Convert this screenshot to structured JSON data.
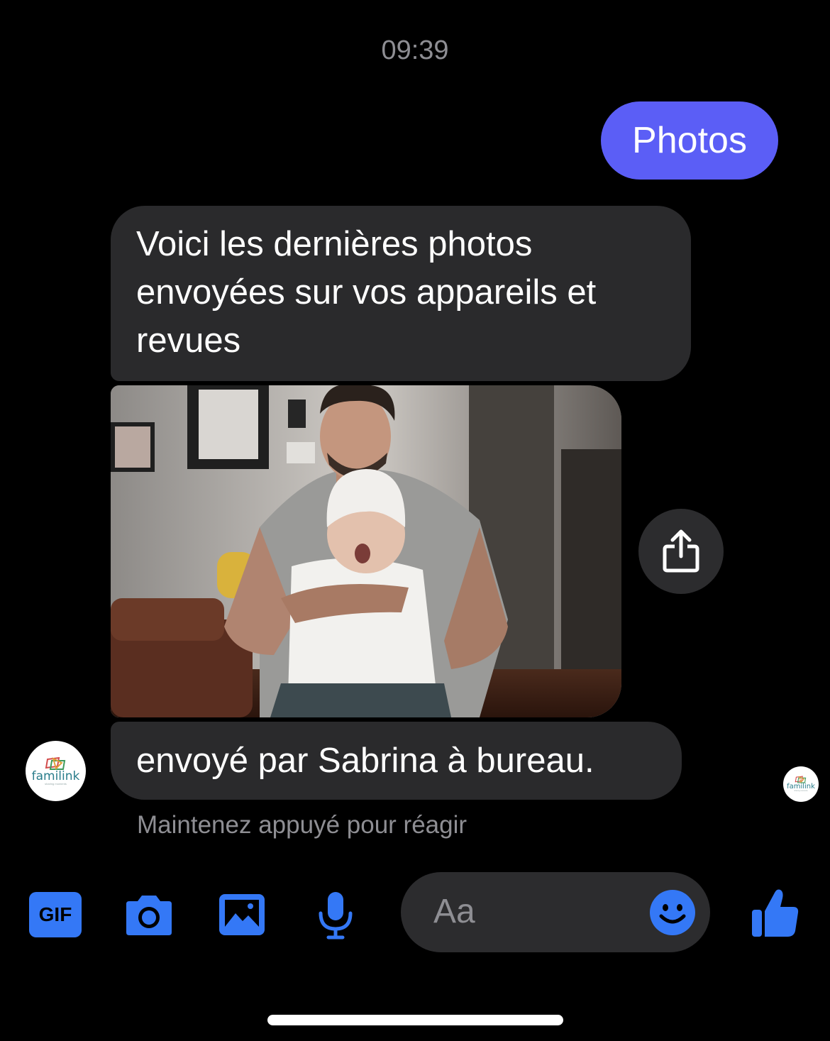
{
  "timestamp": "09:39",
  "messages": {
    "outgoing_text": "Photos",
    "incoming_text": "Voici les dernières photos envoyées sur vos appareils et revues",
    "caption": "envoyé par Sabrina à bureau."
  },
  "hint": "Maintenez appuyé pour réagir",
  "avatar": {
    "brand": "familink",
    "tagline": "sharing moments"
  },
  "composer": {
    "gif_label": "GIF",
    "placeholder": "Aa"
  },
  "colors": {
    "outgoing_bubble": "#5b5ef6",
    "incoming_bubble": "#2a2a2c",
    "accent": "#3478f6"
  },
  "icons": {
    "share": "share-icon",
    "gif": "gif-icon",
    "camera": "camera-icon",
    "gallery": "image-icon",
    "microphone": "microphone-icon",
    "emoji": "emoji-icon",
    "like": "thumbs-up-icon"
  }
}
